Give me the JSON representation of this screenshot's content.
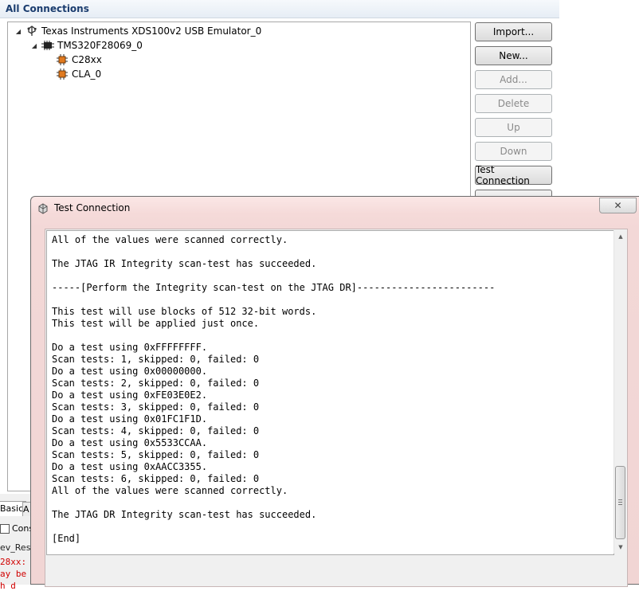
{
  "connections": {
    "title": "All Connections",
    "tree": [
      {
        "label": "Texas Instruments XDS100v2 USB Emulator_0",
        "icon": "usb-emulator-icon",
        "expanded": true
      },
      {
        "label": "TMS320F28069_0",
        "icon": "chip-icon",
        "expanded": true
      },
      {
        "label": "C28xx",
        "icon": "cpu-core-icon"
      },
      {
        "label": "CLA_0",
        "icon": "cpu-core-icon"
      }
    ],
    "buttons": {
      "import": "Import...",
      "new": "New...",
      "add": "Add...",
      "delete": "Delete",
      "up": "Up",
      "down": "Down",
      "test_connection": "Test Connection"
    }
  },
  "bottom": {
    "tab_basic": "Basic",
    "tab_a": "A",
    "console_label": "Cons",
    "dev_label": "ev_Reso",
    "red_lines": [
      "28xx:",
      "ay be",
      "h d"
    ]
  },
  "dialog": {
    "title": "Test Connection",
    "close_glyph": "✕",
    "output_lines": [
      "All of the values were scanned correctly.",
      "",
      "The JTAG IR Integrity scan-test has succeeded.",
      "",
      "-----[Perform the Integrity scan-test on the JTAG DR]------------------------",
      "",
      "This test will use blocks of 512 32-bit words.",
      "This test will be applied just once.",
      "",
      "Do a test using 0xFFFFFFFF.",
      "Scan tests: 1, skipped: 0, failed: 0",
      "Do a test using 0x00000000.",
      "Scan tests: 2, skipped: 0, failed: 0",
      "Do a test using 0xFE03E0E2.",
      "Scan tests: 3, skipped: 0, failed: 0",
      "Do a test using 0x01FC1F1D.",
      "Scan tests: 4, skipped: 0, failed: 0",
      "Do a test using 0x5533CCAA.",
      "Scan tests: 5, skipped: 0, failed: 0",
      "Do a test using 0xAACC3355.",
      "Scan tests: 6, skipped: 0, failed: 0",
      "All of the values were scanned correctly.",
      "",
      "The JTAG DR Integrity scan-test has succeeded.",
      "",
      "[End]"
    ]
  }
}
